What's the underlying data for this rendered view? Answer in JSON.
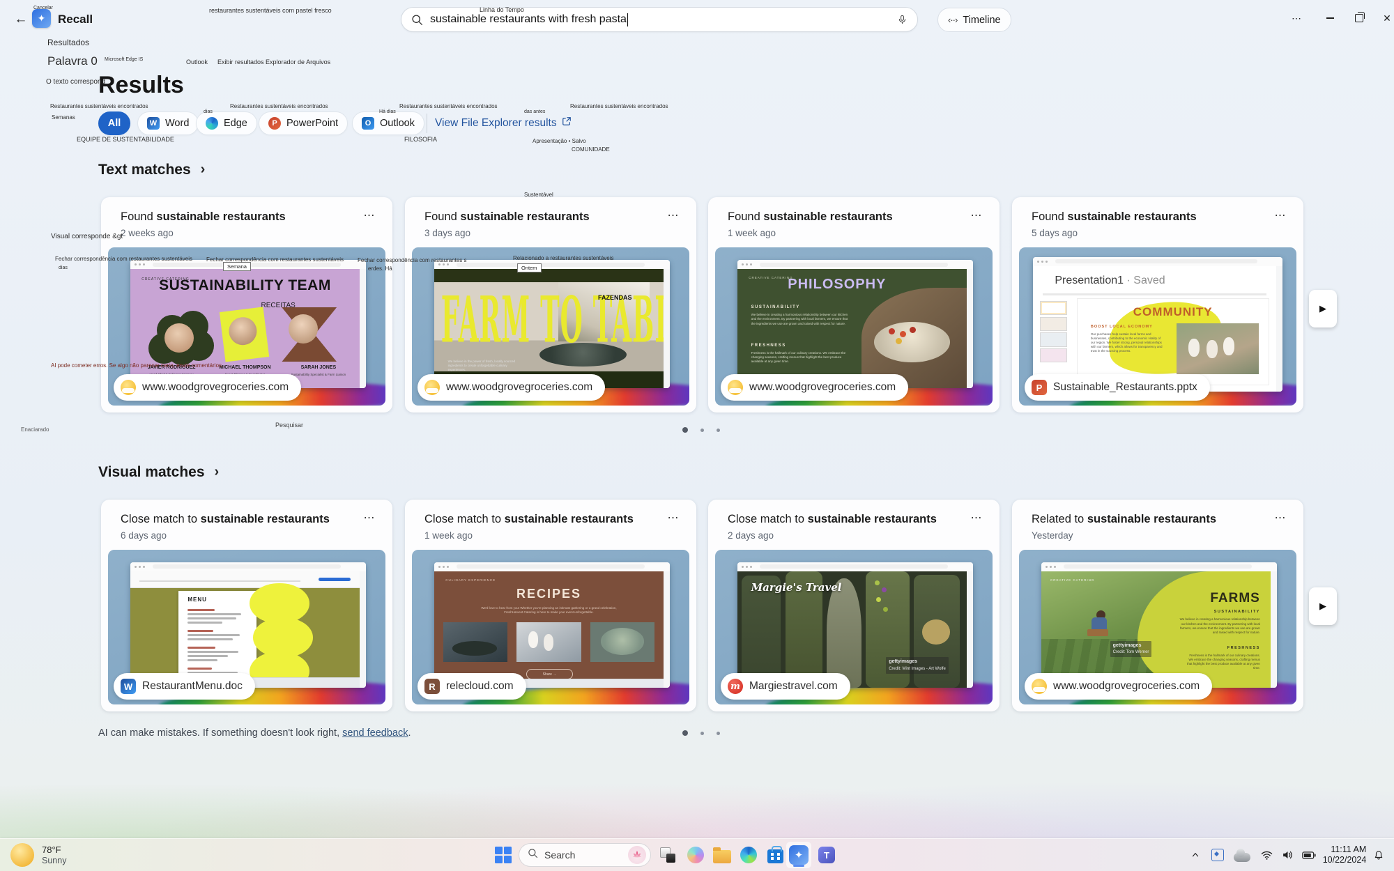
{
  "window": {
    "app_title": "Recall"
  },
  "icons": {
    "back": "←",
    "sparkle": "✦",
    "more_h": "⋯",
    "close": "✕",
    "chevron_right": "›",
    "play": "▶",
    "timeline_glyph": "‹··›",
    "tray_chevron": "⌃"
  },
  "search": {
    "value": "sustainable restaurants with fresh pasta",
    "timeline_label": "Timeline"
  },
  "results": {
    "heading": "Results",
    "filters": [
      {
        "label": "All"
      },
      {
        "label": "Word",
        "icon_letter": "W"
      },
      {
        "label": "Edge"
      },
      {
        "label": "PowerPoint",
        "icon_letter": "P"
      },
      {
        "label": "Outlook",
        "icon_letter": "O"
      }
    ],
    "file_explorer_link": "View File Explorer results"
  },
  "sections": {
    "text_heading": "Text matches",
    "visual_heading": "Visual matches"
  },
  "text_cards": [
    {
      "title_prefix": "Found",
      "title_bold": "sustainable restaurants",
      "time": "2 weeks ago",
      "source": "www.woodgrovegroceries.com",
      "thumb": {
        "brand": "CREATIVE CATERING",
        "title": "SUSTAINABILITY TEAM",
        "tag": "RECEITAS",
        "people": [
          {
            "name": "JAVIER RODRIGUEZ",
            "role": "Head Chef & Culinary Visionary"
          },
          {
            "name": "MICHAEL THOMPSON",
            "role": "Event Planner & Coordinator"
          },
          {
            "name": "SARAH JONES",
            "role": "Sustainability Specialist & Farm Liaison"
          }
        ]
      }
    },
    {
      "title_prefix": "Found",
      "title_bold": "sustainable restaurants",
      "time": "3 days ago",
      "source": "www.woodgrovegroceries.com",
      "thumb": {
        "title": "FARM TO TABLE",
        "caption": "We believe in the power of fresh, locally sourced ingredients to create unforgettable culinary experiences."
      }
    },
    {
      "title_prefix": "Found",
      "title_bold": "sustainable restaurants",
      "time": "1 week ago",
      "source": "www.woodgrovegroceries.com",
      "thumb": {
        "brand": "CREATIVE CATERING",
        "title": "PHILOSOPHY",
        "s1": "SUSTAINABILITY",
        "body1": "We believe in creating a harmonious relationship between our kitchen and the environment. By partnering with local farmers, we ensure that the ingredients we use are grown and raised with respect for nature.",
        "s2": "FRESHNESS",
        "body2": "Freshness is the hallmark of our culinary creations. We embrace the changing seasons, crafting menus that highlight the best produce available at any given time."
      }
    },
    {
      "title_prefix": "Found",
      "title_bold": "sustainable restaurants",
      "time": "5 days ago",
      "source": "Sustainable_Restaurants.pptx",
      "thumb": {
        "doc_title": "Presentation1",
        "doc_status": "· Saved",
        "title": "COMMUNITY",
        "s1": "BOOST LOCAL ECONOMY",
        "body": "Our purchases help sustain local farms and businesses, contributing to the economic vitality of our region. We foster strong, personal relationships with our farmers, which allows for transparency and trust in the sourcing process."
      }
    }
  ],
  "visual_cards": [
    {
      "title_prefix": "Close match to",
      "title_bold": "sustainable restaurants",
      "time": "6 days ago",
      "source": "RestaurantMenu.doc",
      "thumb": {
        "title": "MENU"
      }
    },
    {
      "title_prefix": "Close match to",
      "title_bold": "sustainable restaurants",
      "time": "1 week ago",
      "source": "relecloud.com",
      "thumb": {
        "brand": "CULINARY EXPERIENCE",
        "title": "RECIPES",
        "body": "We'd love to hear from you! Whether you're planning an intimate gathering or a grand celebration, FreshHarvest Catering is here to make your event unforgettable.",
        "share": "Share  →"
      }
    },
    {
      "title_prefix": "Close match to",
      "title_bold": "sustainable restaurants",
      "time": "2 days ago",
      "source": "Margiestravel.com",
      "thumb": {
        "title": "Margie's Travel",
        "watermark": "gettyimages",
        "credit": "Credit: Mint Images - Art Wolfe"
      }
    },
    {
      "title_prefix": "Related to",
      "title_bold": "sustainable restaurants",
      "time": "Yesterday",
      "source": "www.woodgrovegroceries.com",
      "thumb": {
        "brand": "CREATIVE CATERING",
        "title": "FARMS",
        "s1": "SUSTAINABILITY",
        "body1": "We believe in creating a harmonious relationship between our kitchen and the environment. By partnering with local farmers, we ensure that the ingredients we use are grown and raised with respect for nature.",
        "s2": "FRESHNESS",
        "body2": "Freshness is the hallmark of our culinary creations. We embrace the changing seasons, crafting menus that highlight the best produce available at any given time.",
        "watermark": "gettyimages",
        "credit": "Credit: Tom Werner"
      }
    }
  ],
  "overlays": [
    "Cancelar",
    "restaurantes sustentáveis com pastel fresco",
    "Linha do Tempo",
    "Resultados",
    "Palavra 0",
    "Microsoft Edge IS",
    "Outlook",
    "Exibir resultados Explorador de Arquivos",
    "O texto correspond",
    "Restaurantes sustentáveis encontrados",
    "Restaurantes sustentáveis encontrados",
    "Restaurantes sustentáveis encontrados",
    "Restaurantes sustentáveis encontrados",
    "Semanas",
    "dias",
    "Há dias",
    "das antes",
    "EQUIPE DE SUSTENTABILIDADE",
    "FILOSOFIA",
    "Apresentação • Salvo",
    "COMUNIDADE",
    "Sustentável",
    "Visual corresponde &gt",
    "Fechar correspondência com restaurantes sustentáveis",
    "dias",
    "Fechar correspondência com restaurantes sustentáveis",
    "Fechar correspondência com restaurantes s",
    "erdes. Há",
    "Relacionado a restaurantes sustentáveis",
    "Semana",
    "Ontem",
    "FAZENDAS",
    "AI pode cometer erros. Se algo não parecer certo, envie comentários.",
    "Enaciarado",
    "Pesquisar"
  ],
  "footer": {
    "disclaimer_prefix": "AI can make mistakes. If something doesn't look right, ",
    "feedback_link": "send feedback",
    "suffix": "."
  },
  "taskbar": {
    "weather": {
      "temp": "78°F",
      "condition": "Sunny"
    },
    "search_label": "Search",
    "tray": {
      "time": "11:11 AM",
      "date": "10/22/2024"
    }
  }
}
